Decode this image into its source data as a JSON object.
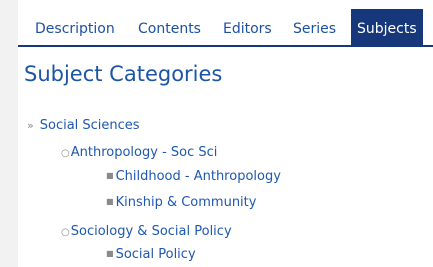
{
  "tabs": [
    {
      "label": "Description",
      "active": false
    },
    {
      "label": "Contents",
      "active": false
    },
    {
      "label": "Editors",
      "active": false
    },
    {
      "label": "Series",
      "active": false
    },
    {
      "label": "Subjects",
      "active": true
    }
  ],
  "heading": "Subject Categories",
  "tree": {
    "root": {
      "marker": "»",
      "label": "Social Sciences"
    },
    "anthropology": {
      "marker": "○",
      "label": "Anthropology - Soc Sci"
    },
    "childhood": {
      "marker": "■",
      "label": "Childhood - Anthropology"
    },
    "kinship": {
      "marker": "■",
      "label": "Kinship & Community"
    },
    "sociology": {
      "marker": "○",
      "label": "Sociology & Social Policy"
    },
    "social_policy": {
      "marker": "■",
      "label": "Social Policy"
    }
  },
  "colors": {
    "tab_active_bg": "#16377a",
    "link": "#1e58b0",
    "heading": "#1d55a5",
    "page_bg": "#f2f2f2"
  }
}
